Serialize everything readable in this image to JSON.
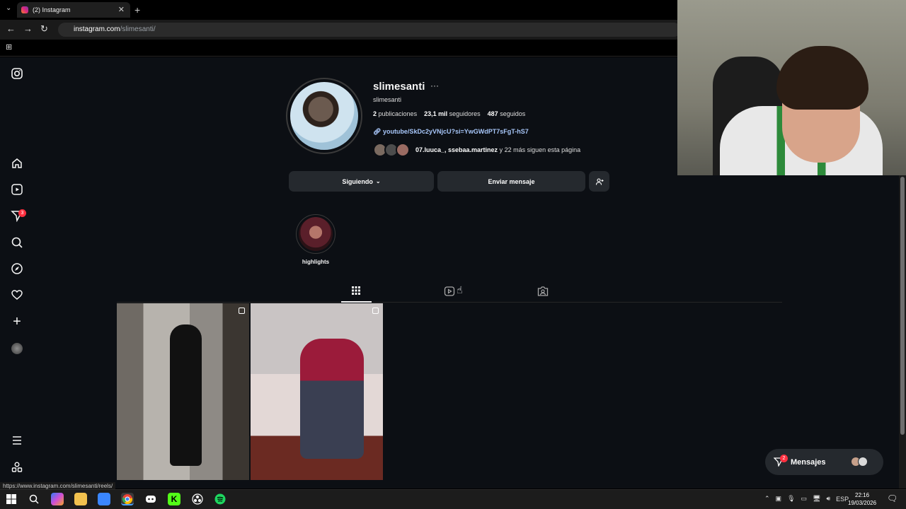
{
  "browser": {
    "tab_title": "(2) Instagram",
    "url_host": "instagram.com",
    "url_path": "/slimesanti/",
    "status_url": "https://www.instagram.com/slimesanti/reels/"
  },
  "sidebar": {
    "notifications_badge": "3"
  },
  "profile": {
    "username": "slimesanti",
    "full_name": "slimesanti",
    "posts_count": "2",
    "posts_label": "publicaciones",
    "followers_count": "23,1 mil",
    "followers_label": "seguidores",
    "following_count": "487",
    "following_label": "seguidos",
    "link": "youtube/SkDc2yVNjcU?si=YwGWdPT7sFgT-hS7",
    "followed_by_names": "07.luuca_, ssebaa.martinez",
    "followed_by_suffix": " y 22 más siguen esta página",
    "following_button": "Siguiendo",
    "message_button": "Enviar mensaje"
  },
  "highlights": [
    {
      "label": "highlights"
    }
  ],
  "messages": {
    "label": "Mensajes",
    "badge": "2"
  },
  "taskbar": {
    "language": "ESP",
    "time": "22:16",
    "date": "19/03/2026"
  }
}
